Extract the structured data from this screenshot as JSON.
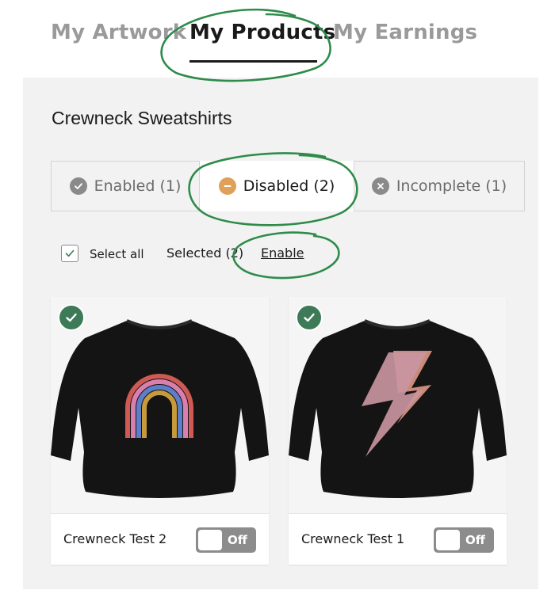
{
  "top_tabs": [
    {
      "label": "My Artwork"
    },
    {
      "label": "My Products",
      "active": true
    },
    {
      "label": "My Earnings"
    }
  ],
  "section": {
    "title": "Crewneck Sweatshirts"
  },
  "status_tabs": [
    {
      "label": "Enabled (1)",
      "icon": "check-circle-icon"
    },
    {
      "label": "Disabled (2)",
      "icon": "minus-circle-icon",
      "active": true
    },
    {
      "label": "Incomplete (1)",
      "icon": "x-circle-icon"
    }
  ],
  "bulk": {
    "select_all_label": "Select all",
    "select_all_checked": true,
    "selected_label": "Selected (2)",
    "enable_label": "Enable"
  },
  "products": [
    {
      "name": "Crewneck Test 2",
      "toggle_label": "Off",
      "selected": true,
      "design": "rainbow"
    },
    {
      "name": "Crewneck Test 1",
      "toggle_label": "Off",
      "selected": true,
      "design": "lightning-bolt"
    }
  ],
  "colors": {
    "annotation_green": "#2e8b4a",
    "check_badge": "#3d7a58",
    "disabled_icon": "#e0a05a",
    "toggle_off": "#8c8c8c",
    "panel_bg": "#f2f2f2"
  }
}
